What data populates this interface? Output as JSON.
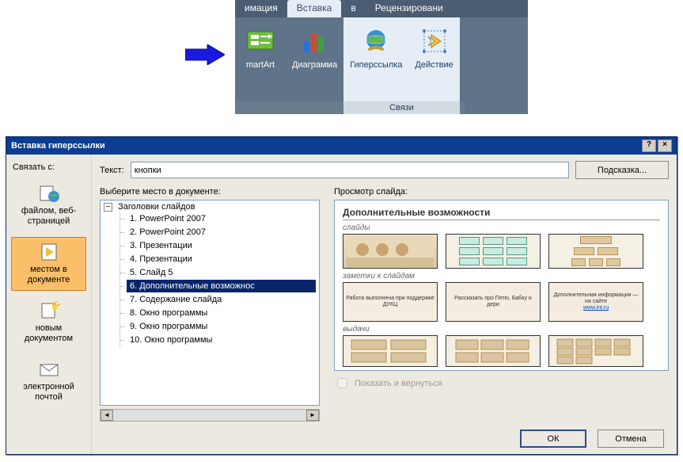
{
  "ribbon": {
    "tabs": {
      "animation": "имация",
      "insert": "Вставка",
      "v": "в",
      "review": "Рецензировани"
    },
    "active_tab": "insert",
    "buttons": {
      "smartart": "martArt",
      "chart": "Диаграмма",
      "hyperlink": "Гиперссылка",
      "action": "Действие"
    },
    "groups": {
      "links": "Связи"
    }
  },
  "dialog": {
    "title": "Вставка гиперссылки",
    "help": "?",
    "close": "×",
    "link_to_label": "Связать с:",
    "text_label": "Текст:",
    "text_value": "кнопки",
    "hint_button": "Подсказка...",
    "linkto": {
      "file_web": "файлом, веб-страницей",
      "place_doc": "местом в документе",
      "new_doc": "новым документом",
      "email": "электронной почтой"
    },
    "tree_label": "Выберите место в документе:",
    "tree_root": "Заголовки слайдов",
    "tree_expand": "−",
    "slides": [
      "1. PowerPoint 2007",
      "2. PowerPoint 2007",
      "3. Презентации",
      "4. Презентации",
      "5. Слайд 5",
      "6. Дополнительные возможнос",
      "7. Содержание слайда",
      "8. Окно программы",
      "9. Окно программы",
      "10. Окно программы"
    ],
    "selected_slide_index": 5,
    "preview_label": "Просмотр слайда:",
    "preview": {
      "title": "Дополнительные возможности",
      "sec1": "слайды",
      "sec2": "заметки к слайдам",
      "sec3": "выдачи",
      "card1": "Работа выполнена при поддержке ДУКЦ",
      "card2": "Рассказать про Петю, Бабку и дери",
      "card3a": "Дополнительная информация — на сайте",
      "card3b": "www.int.ru"
    },
    "show_return": "Показать и вернуться",
    "ok": "ОК",
    "cancel": "Отмена"
  }
}
